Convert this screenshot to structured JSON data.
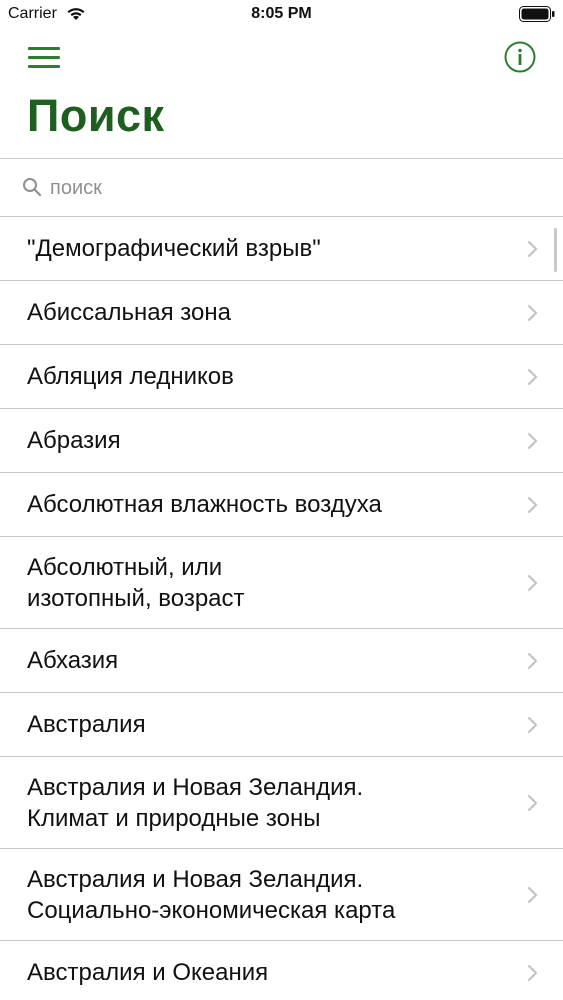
{
  "status": {
    "carrier": "Carrier",
    "time": "8:05 PM"
  },
  "nav": {
    "menu_icon": "hamburger-menu-icon",
    "info_icon": "info-circle-icon",
    "accent_color": "#2e7d2e"
  },
  "header": {
    "title": "Поиск",
    "title_color": "#1e5e1e"
  },
  "search": {
    "placeholder": "поиск",
    "value": ""
  },
  "list": {
    "items": [
      {
        "label": "\"Демографический взрыв\"",
        "lines": 1
      },
      {
        "label": "Абиссальная зона",
        "lines": 1
      },
      {
        "label": "Абляция ледников",
        "lines": 1
      },
      {
        "label": "Абразия",
        "lines": 1
      },
      {
        "label": "Абсолютная влажность воздуха",
        "lines": 1
      },
      {
        "label": "Абсолютный, или\nизотопный, возраст",
        "lines": 2
      },
      {
        "label": "Абхазия",
        "lines": 1
      },
      {
        "label": "Австралия",
        "lines": 1
      },
      {
        "label": "Австралия и Новая Зеландия.\nКлимат и природные зоны",
        "lines": 2
      },
      {
        "label": "Австралия и Новая Зеландия.\nСоциально-экономическая карта",
        "lines": 2
      },
      {
        "label": "Австралия и Океания",
        "lines": 1
      }
    ]
  }
}
